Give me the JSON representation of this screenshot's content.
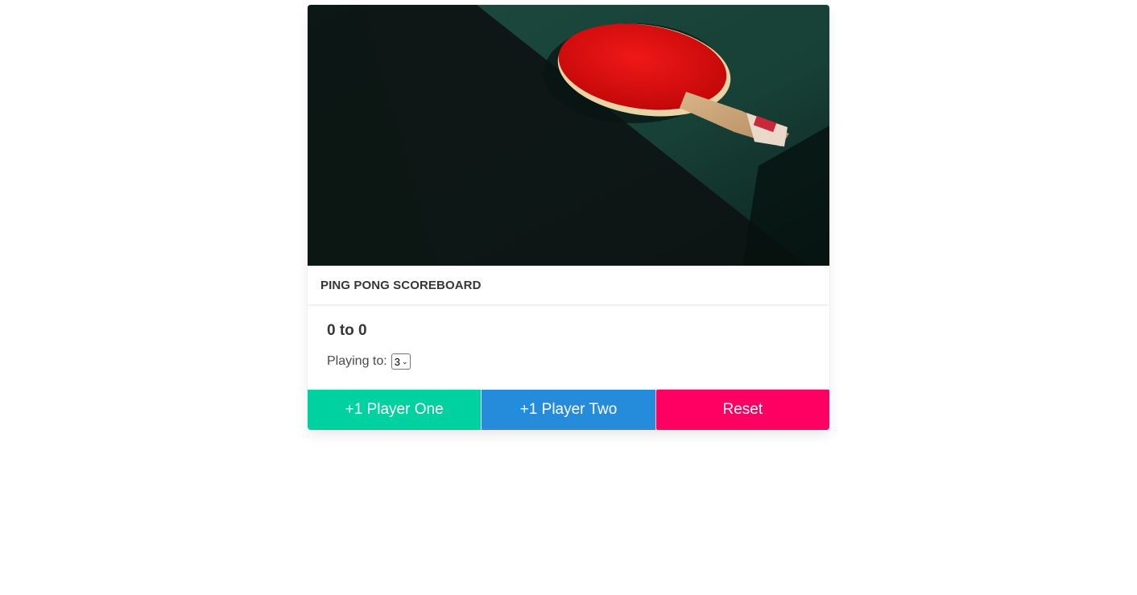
{
  "card": {
    "image_alt": "ping pong paddle",
    "title": "PING PONG SCOREBOARD"
  },
  "score": {
    "text": "0 to 0"
  },
  "playing_to": {
    "label": "Playing to:",
    "selected": "3"
  },
  "buttons": {
    "player_one": "+1 Player One",
    "player_two": "+1 Player Two",
    "reset": "Reset"
  },
  "colors": {
    "player_one": "#00d1a0",
    "player_two": "#258cdb",
    "reset": "#ff0062"
  }
}
